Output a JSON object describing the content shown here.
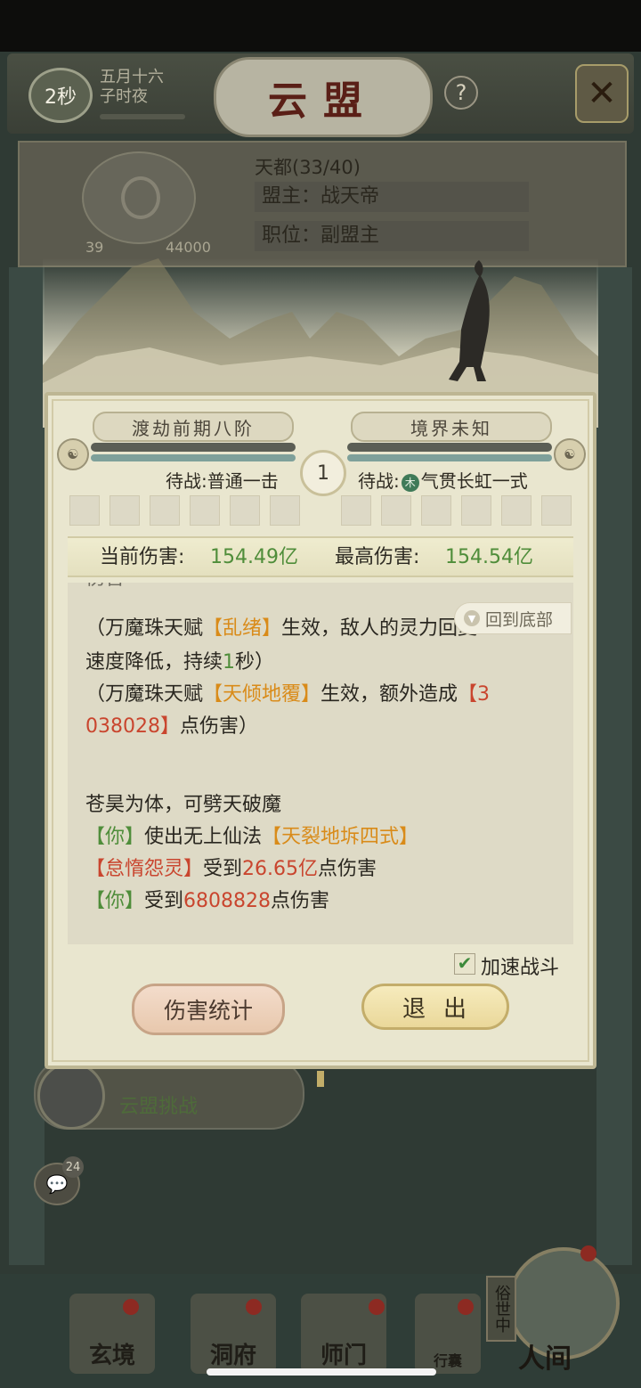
{
  "header": {
    "timer": "2秒",
    "date_line1": "五月十六",
    "date_line2": "子时夜",
    "title": "云盟",
    "help": "?",
    "close": "✕"
  },
  "guild": {
    "name": "天都(33/40)",
    "leader": "盟主：战天帝",
    "position": "职位：副盟主",
    "exp_current": "39",
    "exp_max": "44000"
  },
  "battle": {
    "player_rank": "渡劫前期八阶",
    "enemy_rank": "境界未知",
    "round": "1",
    "player_status": "待战:普通一击",
    "enemy_status_prefix": "待战:",
    "enemy_element": "木",
    "enemy_status_skill": "气贯长虹一式",
    "current_damage_label": "当前伤害:",
    "current_damage_value": "154.49亿",
    "max_damage_label": "最高伤害:",
    "max_damage_value": "154.54亿"
  },
  "log": {
    "scroll_bottom_label": "回到底部",
    "partial_top": "伤害",
    "line1_a": "（万魔珠天赋",
    "line1_b": "【乱绪】",
    "line1_c": "生效，敌人的灵力回复",
    "line2_a": "速度降低，持续",
    "line2_b": "1",
    "line2_c": "秒）",
    "line3_a": "（万魔珠天赋",
    "line3_b": "【天倾地覆】",
    "line3_c": "生效，额外造成",
    "line3_d": "【3",
    "line4_a": "038028】",
    "line4_b": "点伤害）",
    "line5": "苍昊为体，可劈天破魔",
    "line6_a": "【你】",
    "line6_b": "使出无上仙法",
    "line6_c": "【天裂地坼四式】",
    "line7_a": "【怠惰怨灵】",
    "line7_b": "受到",
    "line7_c": "26.65亿",
    "line7_d": "点伤害",
    "line8_a": "【你】",
    "line8_b": "受到",
    "line8_c": "6808828",
    "line8_d": "点伤害"
  },
  "controls": {
    "speed_label": "加速战斗",
    "speed_checked": true,
    "stats_button": "伤害统计",
    "exit_button": "退出"
  },
  "background": {
    "challenge_text": "云盟挑战",
    "chat_count": "24"
  },
  "nav": {
    "items": [
      "玄境",
      "洞府",
      "师门",
      "行囊"
    ],
    "realm_side_label": "俗世中",
    "realm_label": "人间"
  },
  "colors": {
    "damage_green": "#4f8d3a",
    "log_orange": "#d98b19",
    "log_red": "#c9452e",
    "dialog_bg": "#e9e6cf"
  }
}
